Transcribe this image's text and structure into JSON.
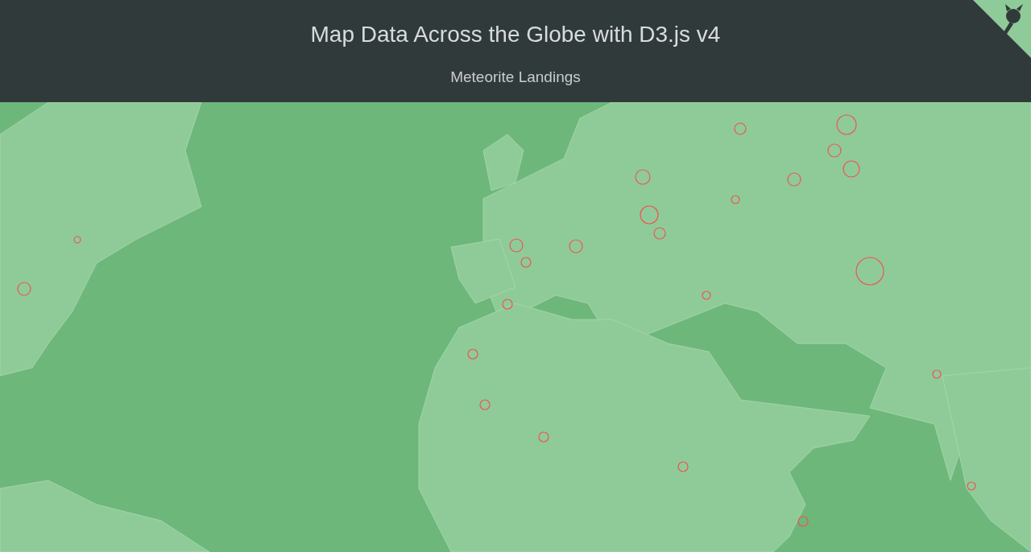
{
  "header": {
    "title": "Map Data Across the Globe with D3.js v4",
    "subtitle": "Meteorite Landings"
  }
}
